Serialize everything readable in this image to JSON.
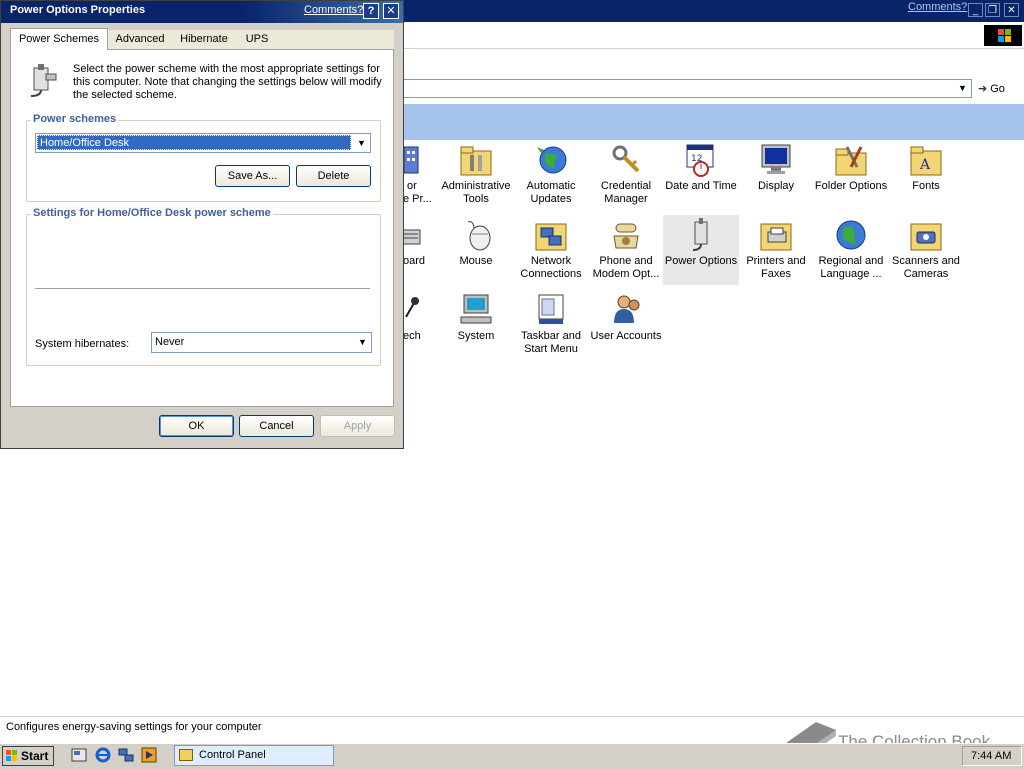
{
  "control_panel": {
    "comments_link": "Comments?",
    "go_label": "Go",
    "icons": [
      {
        "label": "Administrative Tools"
      },
      {
        "label": "Automatic Updates"
      },
      {
        "label": "Credential Manager"
      },
      {
        "label": "Date and Time"
      },
      {
        "label": "Display"
      },
      {
        "label": "Folder Options"
      },
      {
        "label": "Fonts"
      },
      {
        "label": "Mouse"
      },
      {
        "label": "Network Connections"
      },
      {
        "label": "Phone and Modem Opt..."
      },
      {
        "label": "Power Options"
      },
      {
        "label": "Printers and Faxes"
      },
      {
        "label": "Regional and Language ..."
      },
      {
        "label": "Scanners and Cameras"
      },
      {
        "label": "System"
      },
      {
        "label": "Taskbar and Start Menu"
      },
      {
        "label": "User Accounts"
      }
    ],
    "partial_labels": [
      "or",
      "e Pr...",
      "oard",
      "ech"
    ],
    "status_text": "Configures energy-saving settings for your computer"
  },
  "dialog": {
    "title": "Power Options Properties",
    "comments_link": "Comments?",
    "help": "?",
    "close": "✕",
    "tabs": [
      "Power Schemes",
      "Advanced",
      "Hibernate",
      "UPS"
    ],
    "intro": "Select the power scheme with the most appropriate settings for this computer. Note that changing the settings below will modify the selected scheme.",
    "schemes_group_label": "Power schemes",
    "selected_scheme": "Home/Office Desk",
    "save_as_label": "Save As...",
    "delete_label": "Delete",
    "settings_group_label": "Settings for Home/Office Desk power scheme",
    "hibernate_label": "System hibernates:",
    "hibernate_value": "Never",
    "ok_label": "OK",
    "cancel_label": "Cancel",
    "apply_label": "Apply"
  },
  "taskbar": {
    "start_label": "Start",
    "task_label": "Control Panel",
    "clock": "7:44 AM"
  },
  "watermark": "The Collection Book"
}
